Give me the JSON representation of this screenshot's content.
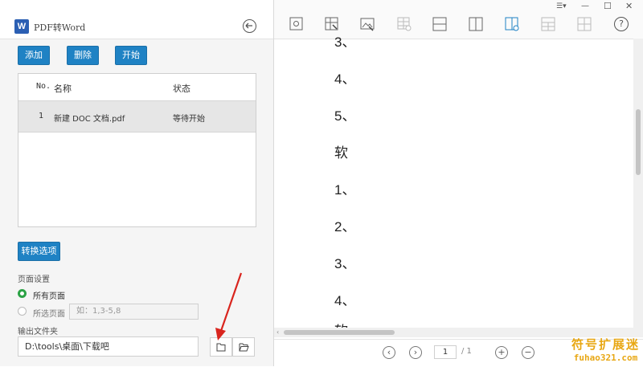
{
  "app": {
    "title": "PDF转Word",
    "logo_text": "W"
  },
  "toolbar": {
    "add_label": "添加",
    "delete_label": "删除",
    "start_label": "开始"
  },
  "table": {
    "headers": {
      "no": "No.",
      "name": "名称",
      "status": "状态"
    },
    "rows": [
      {
        "no": "1",
        "name": "新建 DOC 文档.pdf",
        "status": "等待开始"
      }
    ]
  },
  "options": {
    "convert_label": "转换选项",
    "page_settings_label": "页面设置",
    "all_pages_label": "所有页面",
    "selected_pages_label": "所选页面",
    "pages_placeholder": "如：1,3-5,8"
  },
  "output": {
    "label": "输出文件夹",
    "path": "D:\\tools\\桌面\\下载吧"
  },
  "preview": {
    "lines": [
      "3、",
      "4、",
      "5、",
      "软",
      "1、",
      "2、",
      "3、",
      "4、",
      "软"
    ],
    "page_current": "1",
    "page_total": "/ 1"
  },
  "window_controls": {
    "menu": "☰▾",
    "minimize": "—",
    "maximize": "☐",
    "close": "✕"
  },
  "watermark": {
    "line1": "符号扩展迷",
    "line2": "fuhao321.com"
  },
  "colors": {
    "accent": "#1f82c4",
    "radio_selected": "#2ba245",
    "arrow": "#d9251e"
  }
}
